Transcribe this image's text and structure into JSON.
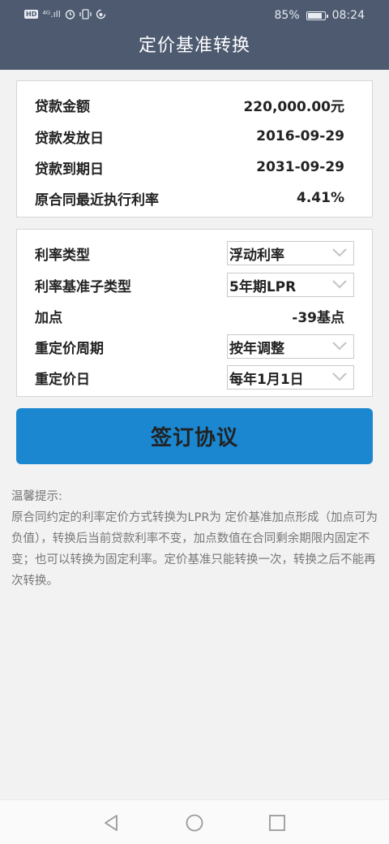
{
  "status_bar": {
    "left_text": "⁴ᴳ.ıll",
    "battery": "85%",
    "battery_level": 0.85,
    "time": "08:24"
  },
  "header": {
    "title": "定价基准转换"
  },
  "loan_info": {
    "amount": {
      "label": "贷款金额",
      "value": "220,000.00元"
    },
    "issue_date": {
      "label": "贷款发放日",
      "value": "2016-09-29"
    },
    "maturity_date": {
      "label": "贷款到期日",
      "value": "2031-09-29"
    },
    "recent_rate": {
      "label": "原合同最近执行利率",
      "value": "4.41%"
    }
  },
  "rate_settings": {
    "rate_type": {
      "label": "利率类型",
      "value": "浮动利率"
    },
    "benchmark_subtype": {
      "label": "利率基准子类型",
      "value": "5年期LPR"
    },
    "spread": {
      "label": "加点",
      "value": "-39基点"
    },
    "repricing_period": {
      "label": "重定价周期",
      "value": "按年调整"
    },
    "repricing_date": {
      "label": "重定价日",
      "value": "每年1月1日"
    }
  },
  "actions": {
    "sign_label": "签订协议"
  },
  "tip": {
    "title": "温馨提示:",
    "body": "原合同约定的利率定价方式转换为LPR为 定价基准加点形成（加点可为负值），转换后当前贷款利率不变，加点数值在合同剩余期限内固定不变；也可以转换为固定利率。定价基准只能转换一次，转换之后不能再次转换。"
  },
  "icons": {
    "hd": "HD",
    "nav_back": "back-triangle-icon",
    "nav_home": "home-circle-icon",
    "nav_recent": "recent-square-icon"
  },
  "colors": {
    "header": "#4d5a70",
    "primary_button": "#1a87d0",
    "background": "#f2f2f2"
  }
}
